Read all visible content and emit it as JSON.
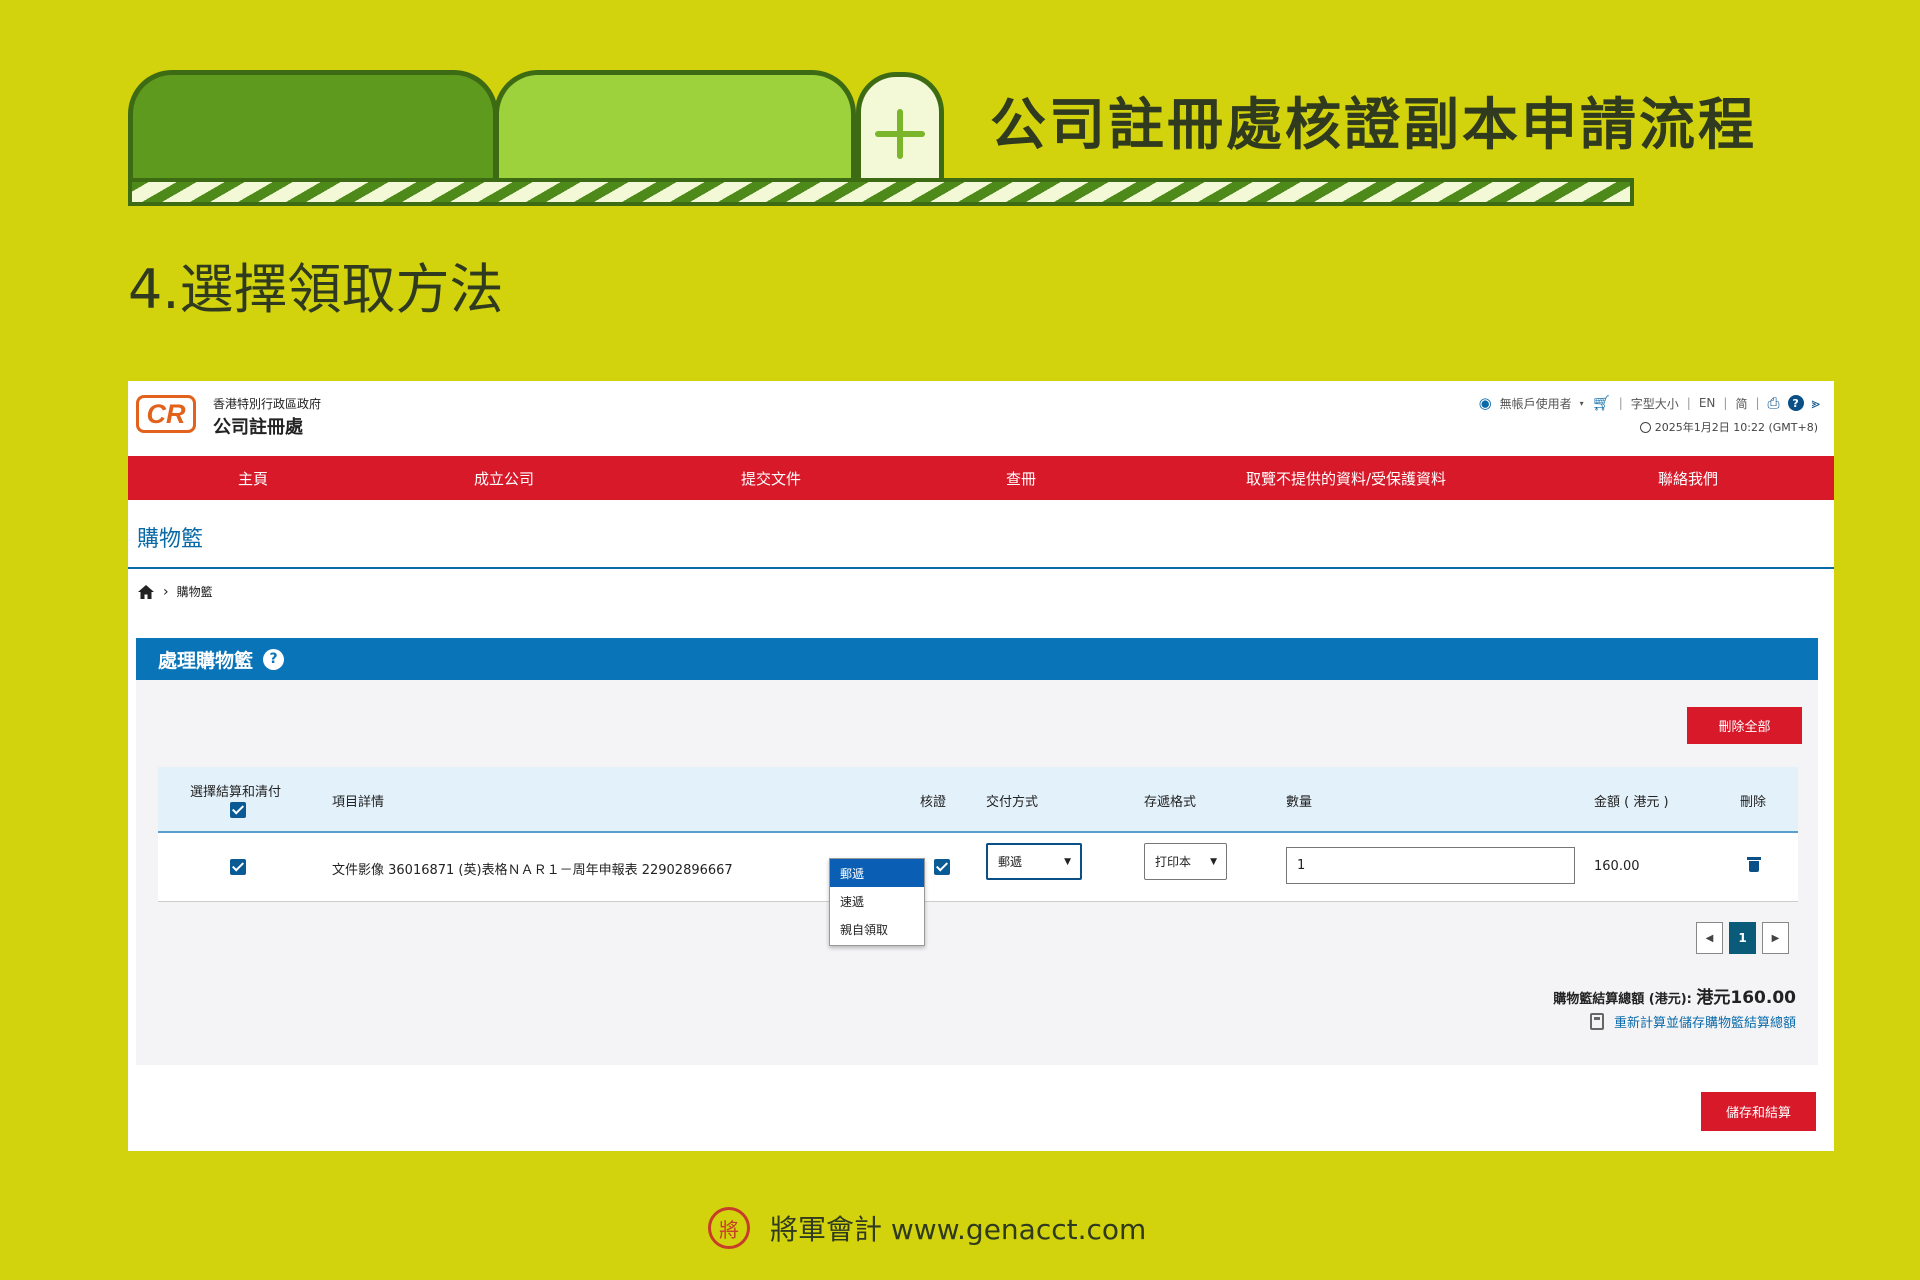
{
  "slide": {
    "title": "公司註冊處核證副本申請流程",
    "step_title": "4.選擇領取方法",
    "footer_text": "將軍會計 www.genacct.com",
    "seal_char": "將"
  },
  "header": {
    "logo_text": "CR",
    "gov_name": "香港特別行政區政府",
    "dept_name": "公司註冊處",
    "user_label": "無帳戶使用者",
    "font_size_label": "字型大小",
    "lang_en": "EN",
    "lang_sc": "简",
    "datetime": "2025年1月2日 10:22 (GMT+8)"
  },
  "nav": {
    "items": [
      "主頁",
      "成立公司",
      "提交文件",
      "查冊",
      "取覽不提供的資料/受保護資料",
      "聯絡我們"
    ]
  },
  "page": {
    "heading": "購物籃",
    "breadcrumb_current": "購物籃",
    "section_title": "處理購物籃"
  },
  "buttons": {
    "delete_all": "刪除全部",
    "save_checkout": "儲存和結算"
  },
  "table": {
    "headers": {
      "select": "選擇結算和清付",
      "item": "項目詳情",
      "certify": "核證",
      "delivery": "交付方式",
      "format": "存遞格式",
      "quantity": "數量",
      "amount": "金額 ( 港元 )",
      "delete": "刪除"
    },
    "rows": [
      {
        "item": "文件影像 36016871 (英)表格ＮＡＲ１－周年申報表 22902896667",
        "delivery": "郵遞",
        "format": "打印本",
        "quantity": "1",
        "amount": "160.00"
      }
    ]
  },
  "dropdown": {
    "options": [
      "郵遞",
      "速遞",
      "親自領取"
    ],
    "selected_index": 0
  },
  "pager": {
    "current": "1"
  },
  "totals": {
    "label": "購物籃結算總額 (港元): ",
    "amount": "港元160.00",
    "recalc": "重新計算並儲存購物籃結算總額"
  },
  "colors": {
    "background": "#d3d30d",
    "nav_red": "#d7192a",
    "section_blue": "#0a74b8"
  }
}
